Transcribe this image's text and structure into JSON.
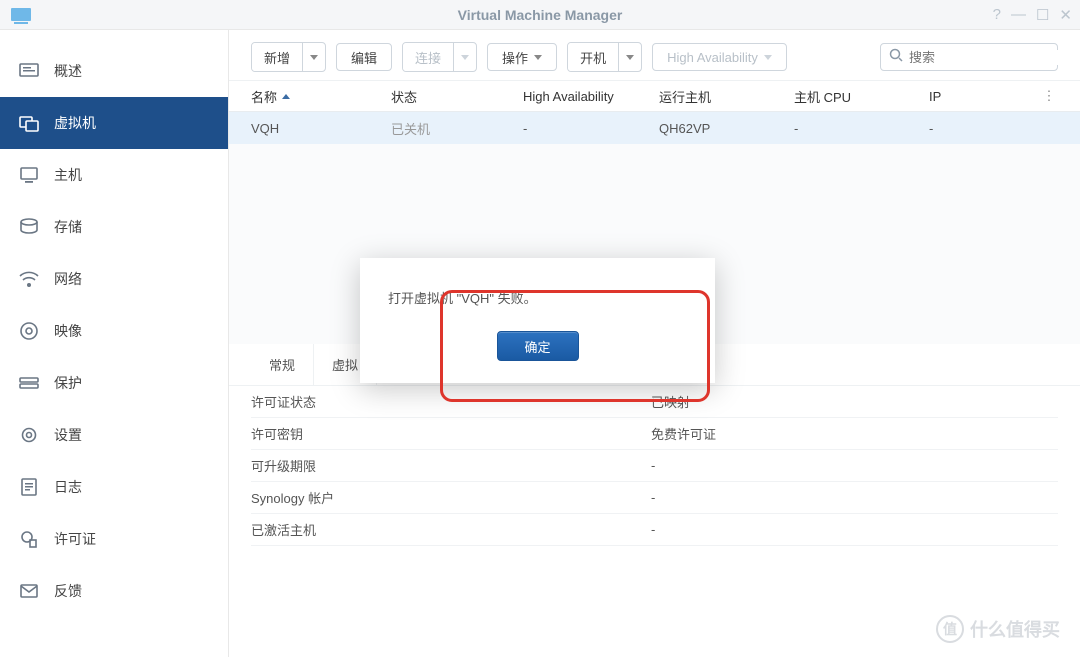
{
  "window": {
    "title": "Virtual Machine Manager"
  },
  "sidebar": {
    "items": [
      {
        "label": "概述",
        "icon": "overview-icon"
      },
      {
        "label": "虚拟机",
        "icon": "vm-icon"
      },
      {
        "label": "主机",
        "icon": "host-icon"
      },
      {
        "label": "存储",
        "icon": "storage-icon"
      },
      {
        "label": "网络",
        "icon": "network-icon"
      },
      {
        "label": "映像",
        "icon": "image-icon"
      },
      {
        "label": "保护",
        "icon": "protect-icon"
      },
      {
        "label": "设置",
        "icon": "settings-icon"
      },
      {
        "label": "日志",
        "icon": "log-icon"
      },
      {
        "label": "许可证",
        "icon": "license-icon"
      },
      {
        "label": "反馈",
        "icon": "feedback-icon"
      }
    ],
    "active_index": 1
  },
  "toolbar": {
    "add": "新增",
    "edit": "编辑",
    "connect": "连接",
    "operate": "操作",
    "poweron": "开机",
    "ha": "High Availability",
    "search_placeholder": "搜索"
  },
  "table": {
    "headers": {
      "name": "名称",
      "status": "状态",
      "ha": "High Availability",
      "running_host": "运行主机",
      "host_cpu": "主机 CPU",
      "ip": "IP"
    },
    "rows": [
      {
        "name": "VQH",
        "status": "已关机",
        "ha": "-",
        "running_host": "QH62VP",
        "host_cpu": "-",
        "ip": "-"
      }
    ]
  },
  "tabs": {
    "t0": "常规",
    "t1": "虚拟"
  },
  "detail": {
    "rows": [
      {
        "label": "许可证状态",
        "value": "已映射"
      },
      {
        "label": "许可密钥",
        "value": "免费许可证"
      },
      {
        "label": "可升级期限",
        "value": "-"
      },
      {
        "label": "Synology 帐户",
        "value": "-"
      },
      {
        "label": "已激活主机",
        "value": "-"
      }
    ]
  },
  "modal": {
    "message": "打开虚拟机 \"VQH\" 失败。",
    "ok": "确定"
  },
  "watermark": {
    "text": "什么值得买"
  }
}
